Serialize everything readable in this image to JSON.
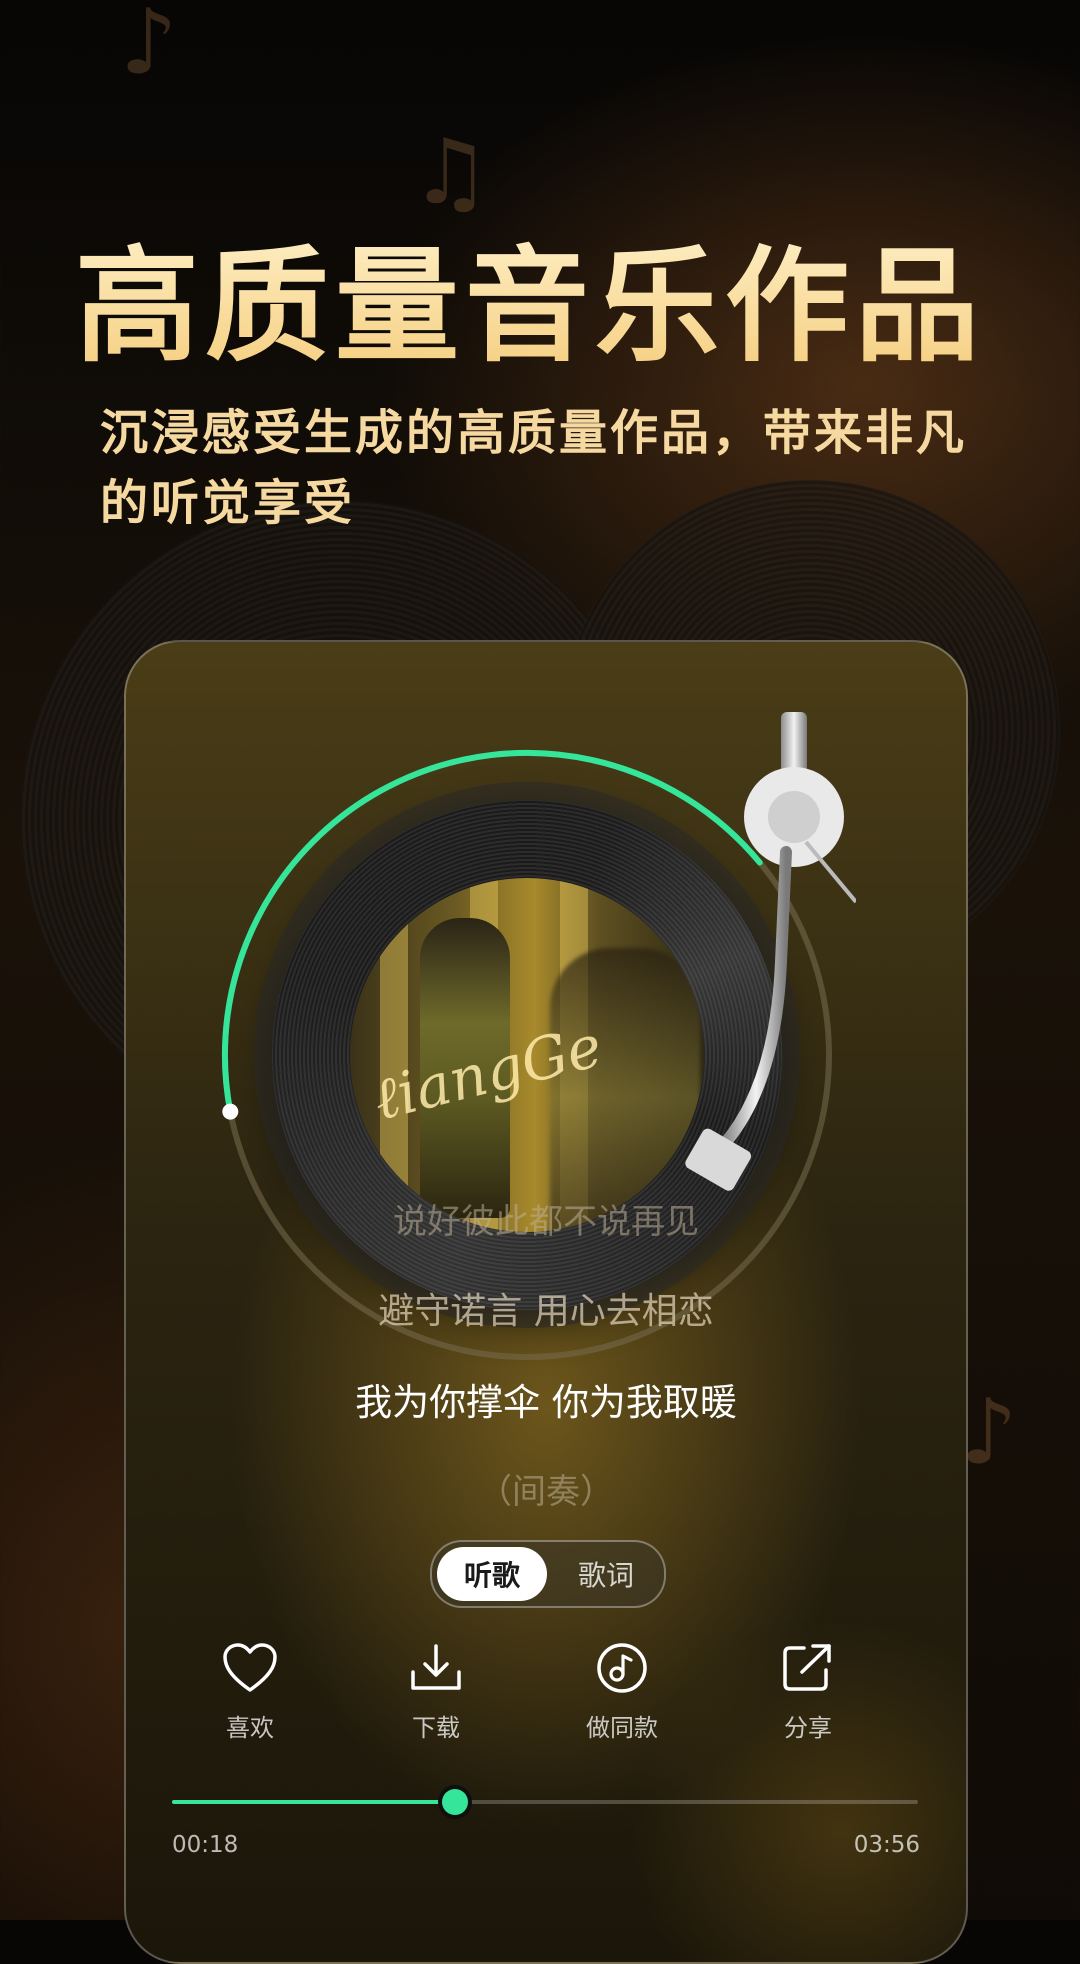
{
  "headline": "高质量音乐作品",
  "subheadline": "沉浸感受生成的高质量作品，带来非凡的听觉享受",
  "player": {
    "lyrics": {
      "line1": "说好彼此都不说再见",
      "line2": "避守诺言 用心去相恋",
      "current": "我为你撑伞 你为我取暖",
      "next": "（间奏）"
    },
    "toggle": {
      "listen": "听歌",
      "lyrics": "歌词",
      "selected": "听歌"
    },
    "actions": {
      "like": "喜欢",
      "download": "下载",
      "make_same": "做同款",
      "share": "分享"
    },
    "time_elapsed": "00:18",
    "time_total": "03:56",
    "progress_fraction": 0.38,
    "ring_progress_fraction": 0.42
  },
  "colors": {
    "accent": "#34e59a",
    "headline_gold": "#f6d9a0"
  },
  "icons": [
    "heart-icon",
    "download-icon",
    "music-note-icon",
    "share-icon",
    "tonearm-icon"
  ]
}
